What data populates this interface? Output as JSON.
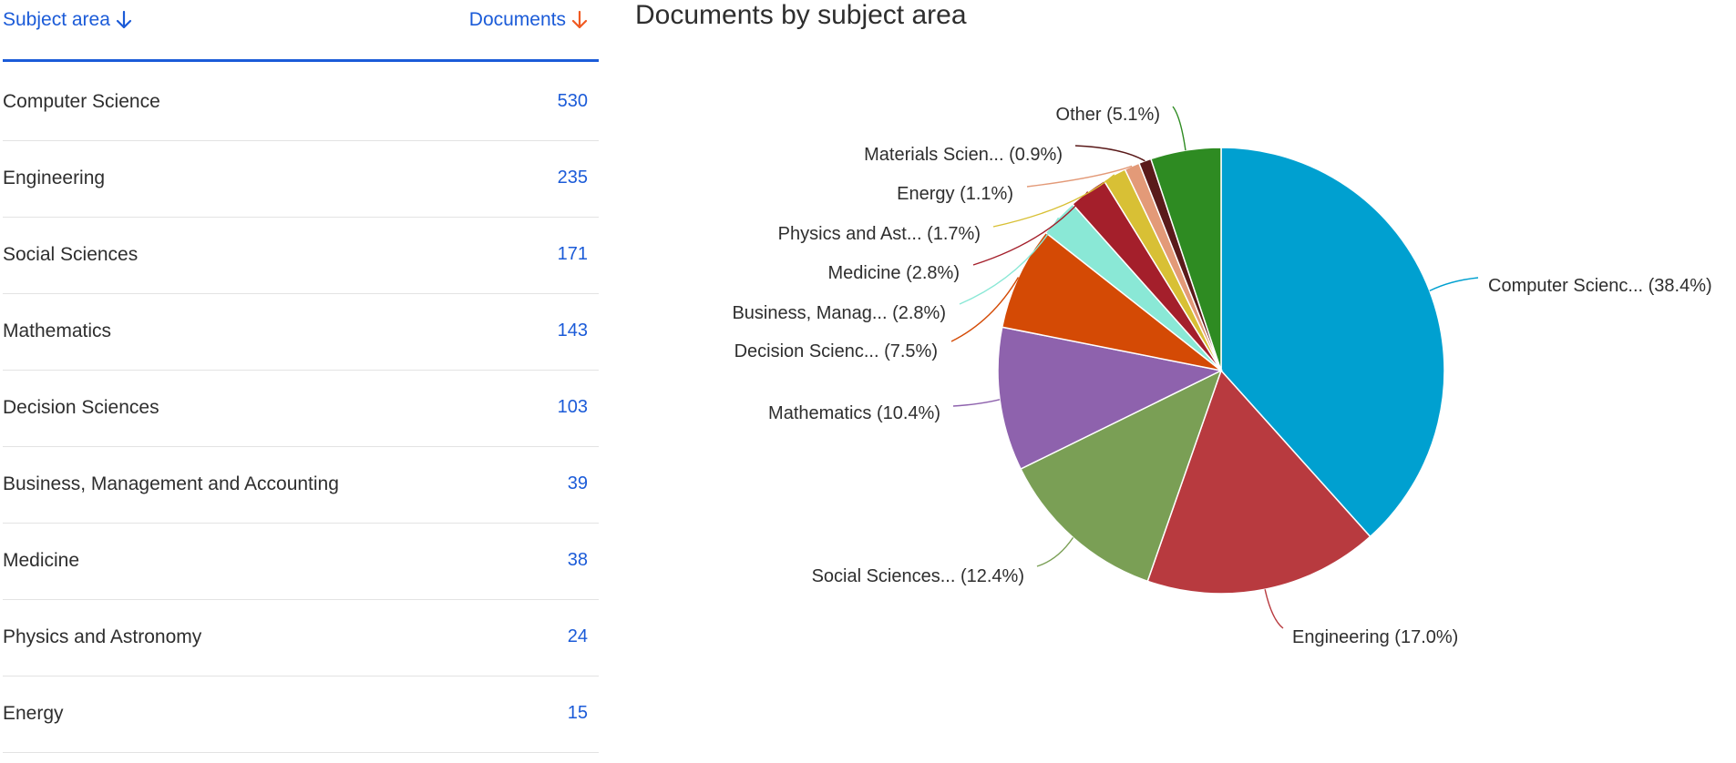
{
  "table": {
    "header": {
      "subject_label": "Subject area",
      "documents_label": "Documents",
      "subject_sort_color": "#1b5bd8",
      "documents_sort_color": "#f05a22"
    },
    "rows": [
      {
        "subject": "Computer Science",
        "documents": "530"
      },
      {
        "subject": "Engineering",
        "documents": "235"
      },
      {
        "subject": "Social Sciences",
        "documents": "171"
      },
      {
        "subject": "Mathematics",
        "documents": "143"
      },
      {
        "subject": "Decision Sciences",
        "documents": "103"
      },
      {
        "subject": "Business, Management and Accounting",
        "documents": "39"
      },
      {
        "subject": "Medicine",
        "documents": "38"
      },
      {
        "subject": "Physics and Astronomy",
        "documents": "24"
      },
      {
        "subject": "Energy",
        "documents": "15"
      }
    ]
  },
  "chart_data": {
    "type": "pie",
    "title": "Documents by subject area",
    "slices": [
      {
        "label": "Computer Scienc...",
        "percent": 38.4,
        "color": "#00a0d0"
      },
      {
        "label": "Engineering",
        "percent": 17.0,
        "color": "#b83a3f"
      },
      {
        "label": "Social Sciences...",
        "percent": 12.4,
        "color": "#7a9f55"
      },
      {
        "label": "Mathematics",
        "percent": 10.4,
        "color": "#8e62ad"
      },
      {
        "label": "Decision Scienc...",
        "percent": 7.5,
        "color": "#d44a05"
      },
      {
        "label": "Business, Manag...",
        "percent": 2.8,
        "color": "#8ae8d6"
      },
      {
        "label": "Medicine",
        "percent": 2.8,
        "color": "#a41f2b"
      },
      {
        "label": "Physics and Ast...",
        "percent": 1.7,
        "color": "#d8c035"
      },
      {
        "label": "Energy",
        "percent": 1.1,
        "color": "#e39a78"
      },
      {
        "label": "Materials Scien...",
        "percent": 0.9,
        "color": "#5a1a1a"
      },
      {
        "label": "Other",
        "percent": 5.1,
        "color": "#2e8b22"
      }
    ],
    "label_format": "{label} ({percent}%)",
    "start_angle_deg": 0,
    "direction": "clockwise"
  }
}
